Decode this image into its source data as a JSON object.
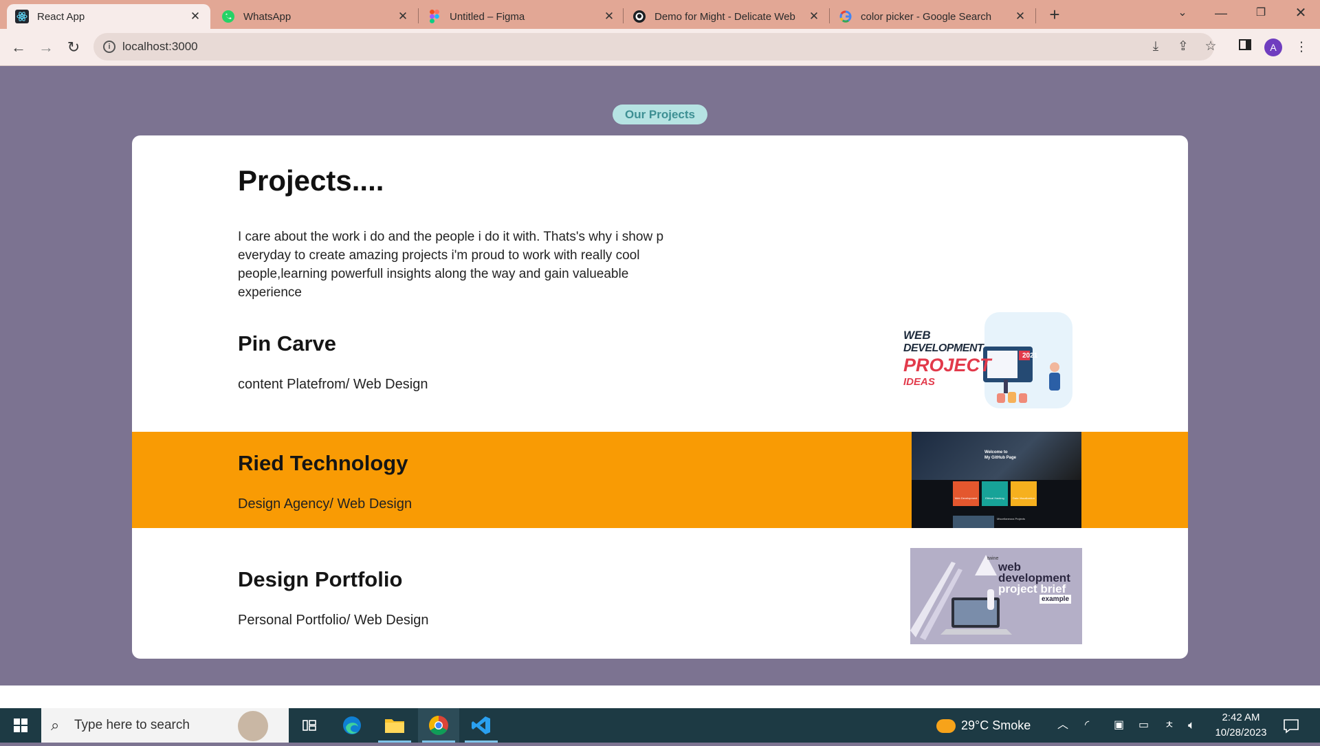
{
  "browser": {
    "tabs": [
      {
        "title": "React App",
        "icon": "react-icon",
        "active": true
      },
      {
        "title": "WhatsApp",
        "icon": "whatsapp-icon",
        "active": false
      },
      {
        "title": "Untitled – Figma",
        "icon": "figma-icon",
        "active": false
      },
      {
        "title": "Demo for Might - Delicate Web",
        "icon": "github-icon",
        "active": false
      },
      {
        "title": "color picker - Google Search",
        "icon": "google-icon",
        "active": false
      }
    ],
    "url": "localhost:3000",
    "profile_initial": "A"
  },
  "page": {
    "badge": "Our Projects",
    "heading": "Projects....",
    "intro": "I care about the work i do and the people i do it with. Thats's why i show p everyday to create amazing projects i'm proud to work with really cool people,learning powerfull insights along the way and gain valueable experience",
    "projects": [
      {
        "title": "Pin Carve",
        "subtitle": "content Platefrom/ Web Design",
        "thumb_text": [
          "WEB",
          "DEVELOPMENT",
          "PROJECT",
          "IDEAS",
          "2021"
        ]
      },
      {
        "title": "Ried Technology",
        "subtitle": "Design Agency/ Web Design",
        "thumb_text": [
          "Welcome to",
          "My GitHub Page",
          "Web Development",
          "Ethical Hacking",
          "Data Visualization",
          "Miscellaneous Projects"
        ]
      },
      {
        "title": "Design Portfolio",
        "subtitle": "Personal Portfolio/ Web Design",
        "thumb_text": [
          "twine",
          "web",
          "development",
          "project brief",
          "example"
        ]
      }
    ],
    "colors": {
      "background": "#7c7391",
      "card": "#ffffff",
      "highlight_row": "#f99b04",
      "badge_bg": "#b6e3e3",
      "badge_text": "#3d8f93"
    }
  },
  "taskbar": {
    "search_placeholder": "Type here to search",
    "weather": "29°C  Smoke",
    "time": "2:42 AM",
    "date": "10/28/2023"
  }
}
